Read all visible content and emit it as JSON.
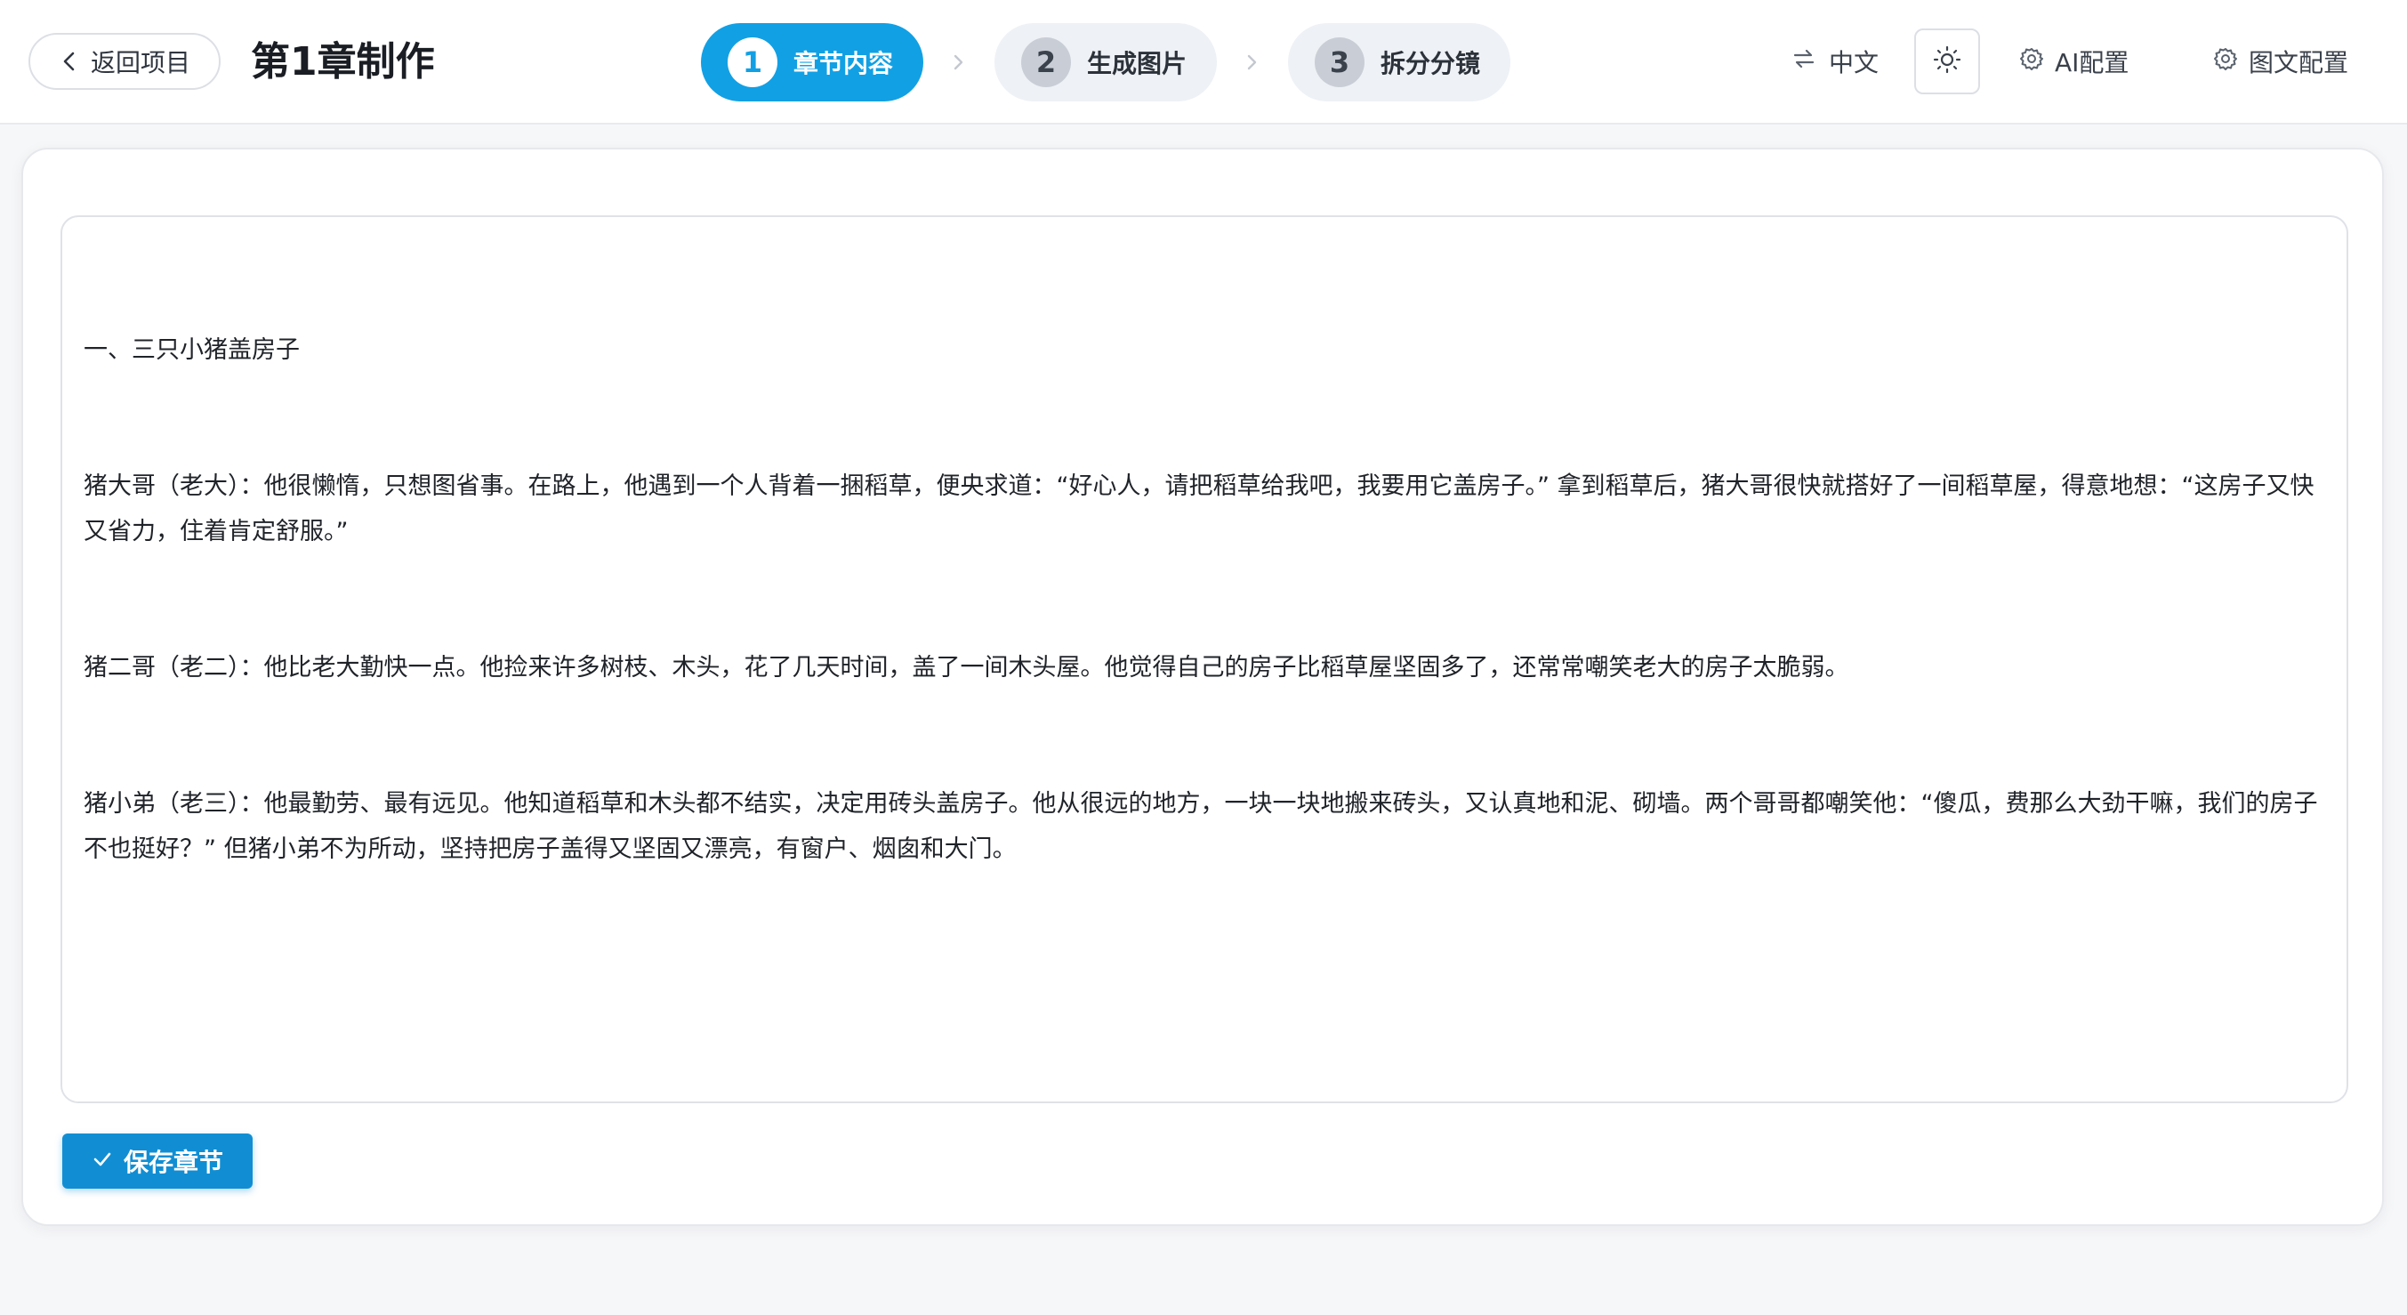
{
  "header": {
    "back_label": "返回项目",
    "title": "第1章制作",
    "language_label": "中文",
    "ai_config_label": "AI配置",
    "text_config_label": "图文配置"
  },
  "steps": [
    {
      "number": "1",
      "label": "章节内容",
      "active": true
    },
    {
      "number": "2",
      "label": "生成图片",
      "active": false
    },
    {
      "number": "3",
      "label": "拆分分镜",
      "active": false
    }
  ],
  "editor": {
    "lines": [
      "一、三只小猪盖房子",
      "猪大哥（老大）：他很懒惰，只想图省事。在路上，他遇到一个人背着一捆稻草，便央求道：“好心人，请把稻草给我吧，我要用它盖房子。” 拿到稻草后，猪大哥很快就搭好了一间稻草屋，得意地想：“这房子又快又省力，住着肯定舒服。”",
      "猪二哥（老二）：他比老大勤快一点。他捡来许多树枝、木头，花了几天时间，盖了一间木头屋。他觉得自己的房子比稻草屋坚固多了，还常常嘲笑老大的房子太脆弱。",
      "猪小弟（老三）：他最勤劳、最有远见。他知道稻草和木头都不结实，决定用砖头盖房子。他从很远的地方，一块一块地搬来砖头，又认真地和泥、砌墙。两个哥哥都嘲笑他：“傻瓜，费那么大劲干嘛，我们的房子不也挺好？” 但猪小弟不为所动，坚持把房子盖得又坚固又漂亮，有窗户、烟囱和大门。"
    ]
  },
  "save_label": "保存章节",
  "colors": {
    "accent": "#12a0e4",
    "save_button": "#118ed3"
  },
  "icons": {
    "back": "chevron-left-icon",
    "language": "swap-icon",
    "theme": "sun-icon",
    "config": "gear-icon",
    "save": "check-icon"
  }
}
